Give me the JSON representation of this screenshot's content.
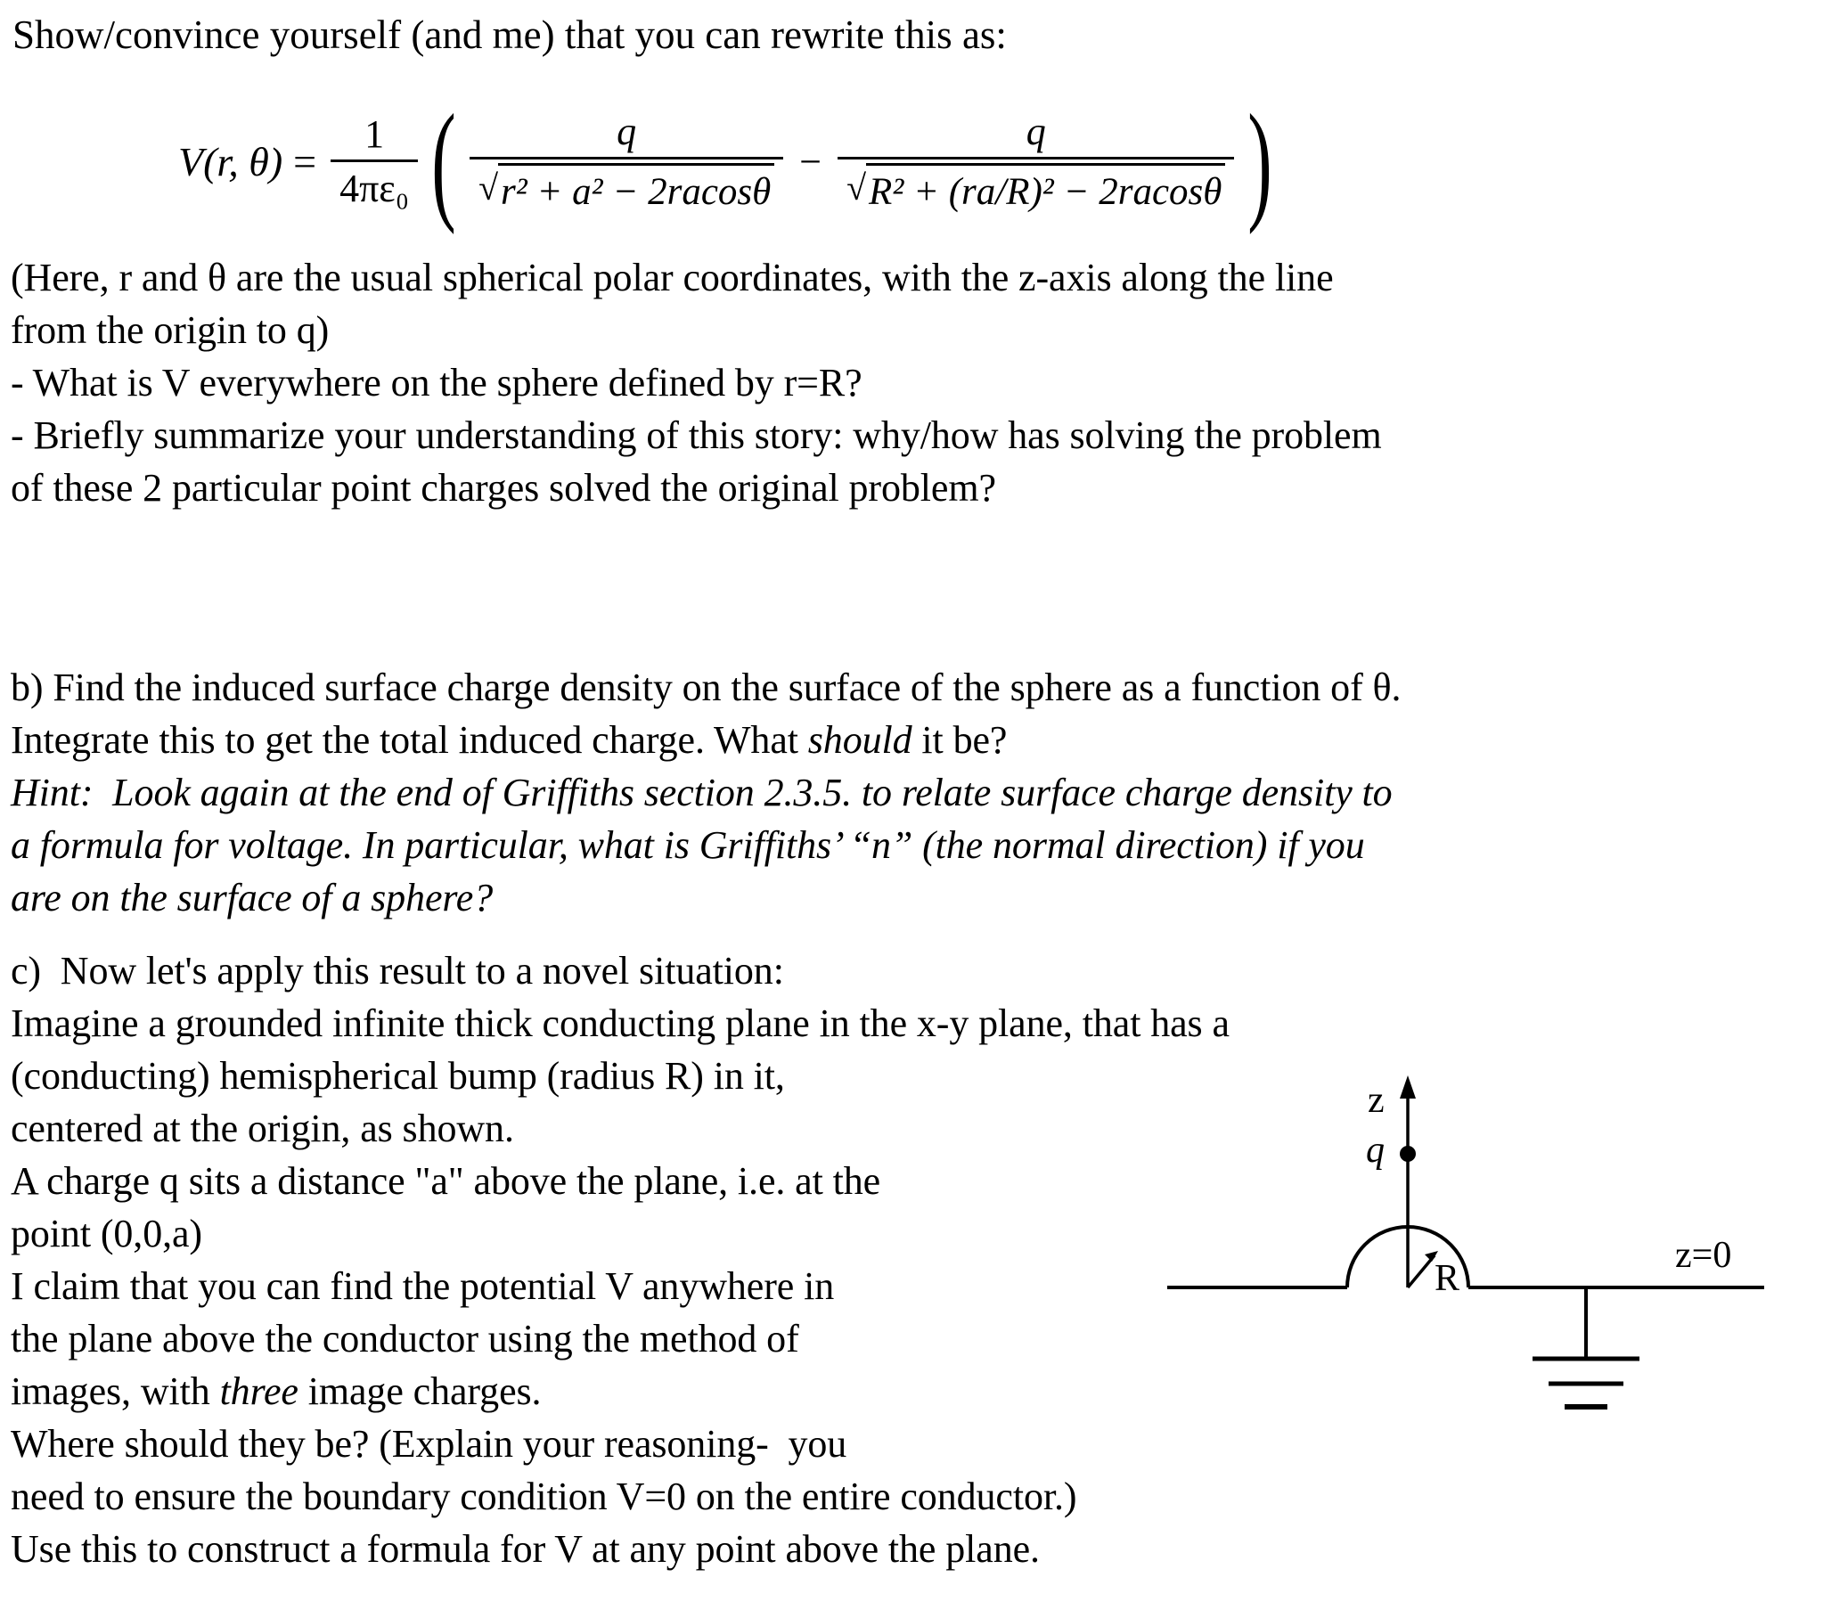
{
  "document": {
    "intro_line": "Show/convince yourself (and me) that you can rewrite this as:",
    "formula": {
      "lhs": "V(r, θ)",
      "equals": "=",
      "prefactor_num": "1",
      "prefactor_den": "4πε₀",
      "open_paren": "(",
      "close_paren": ")",
      "term1_num": "q",
      "term1_den_radicand": "r² + a² − 2racosθ",
      "operator": "−",
      "term2_num": "q",
      "term2_den_radicand": "R² + (ra/R)² − 2racosθ",
      "radical_sign": "√",
      "latex": "V(r,θ) = (1/4πε₀) ( q/√(r²+a²−2racosθ) − q/√(R²+(ra/R)²−2racosθ) )"
    },
    "paragraph_a_notes": {
      "line1": "(Here, r and θ are the usual spherical polar coordinates, with the z-axis along the line",
      "line2": "from the origin to q)",
      "line3": "- What is V everywhere on the sphere defined by r=R?",
      "line4": "- Briefly summarize your understanding of this story: why/how has solving the problem",
      "line5": "of these 2 particular point charges solved the original problem?"
    },
    "part_b": {
      "line1": "b) Find the induced surface charge density on the surface of the sphere as a function of θ.",
      "line2_pre": "Integrate this to get the total induced charge. What ",
      "line2_italic": "should",
      "line2_post": " it be?",
      "hint_line1": "Hint:  Look again at the end of Griffiths section 2.3.5. to relate surface charge density to",
      "hint_line2": "a formula for voltage. In particular, what is Griffiths’ “n” (the normal direction) if you",
      "hint_line3": "are on the surface of a sphere?"
    },
    "part_c": {
      "line1": "c)  Now let's apply this result to a novel situation:",
      "line2": "Imagine a grounded infinite thick conducting plane in the x-y plane, that has a",
      "line3": "(conducting) hemispherical bump (radius R) in it,",
      "line4": "centered at the origin, as shown.",
      "line5": "A charge q sits a distance \"a\" above the plane, i.e. at the",
      "line6": "point (0,0,a)",
      "line7": "I claim that you can find the potential V anywhere in",
      "line8": "the plane above the conductor using the method of",
      "line9_pre": "images, with ",
      "line9_italic": "three",
      "line9_post": " image charges.",
      "line10": "Where should they be? (Explain your reasoning-  you",
      "line11": "need to ensure the boundary condition V=0 on the entire conductor.)",
      "line12": "Use this to construct a formula for V at any point above the plane."
    },
    "diagram": {
      "axis_label_z": "z",
      "charge_label": "q",
      "radius_label": "R",
      "plane_label": "z=0",
      "stroke_color": "#000000"
    }
  }
}
